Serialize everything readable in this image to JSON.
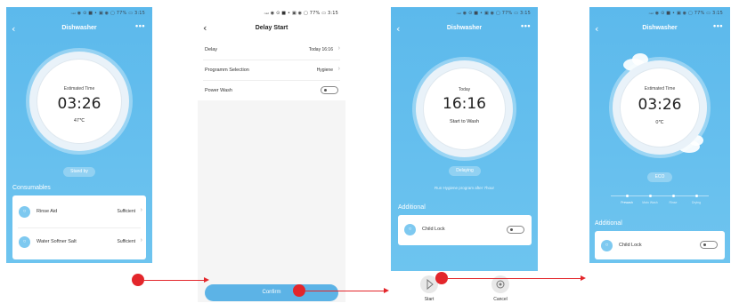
{
  "status": "ₙₐₗ ◉ ⊙ ■ • ▣ ◉ ▢ 77% ▭ 3:15",
  "s1": {
    "title": "Dishwasher",
    "ring_label": "Estimated Time",
    "time": "03:26",
    "temp": "47℃",
    "pill": "Stand by",
    "section": "Consumables",
    "items": [
      {
        "label": "Rinse Aid",
        "value": "Sufficient"
      },
      {
        "label": "Water Softner Salt",
        "value": "Sufficient"
      }
    ]
  },
  "s2": {
    "title": "Delay Start",
    "rows": [
      {
        "label": "Delay",
        "value": "Today 16:16"
      },
      {
        "label": "Programm Selection",
        "value": "Hygiene"
      },
      {
        "label": "Power Wash",
        "value": ""
      }
    ],
    "confirm": "Confirm"
  },
  "s3": {
    "title": "Dishwasher",
    "ring_label": "Today",
    "time": "16:16",
    "sub": "Start to Wash",
    "pill": "Delaying",
    "note": "Run Hygiene program after 7hour",
    "section": "Additional",
    "child_lock": "Child Lock",
    "start": "Start",
    "cancel": "Cancel"
  },
  "s4": {
    "title": "Dishwasher",
    "ring_label": "Estimated Time",
    "time": "03:26",
    "temp": "0℃",
    "pill": "ECO",
    "modes": [
      "Prewash",
      "Main Wash",
      "Rinse",
      "Drying"
    ],
    "section": "Additional",
    "child_lock": "Child Lock"
  },
  "colors": {
    "accent": "#5cb9ec",
    "arrow": "#e3262b"
  }
}
